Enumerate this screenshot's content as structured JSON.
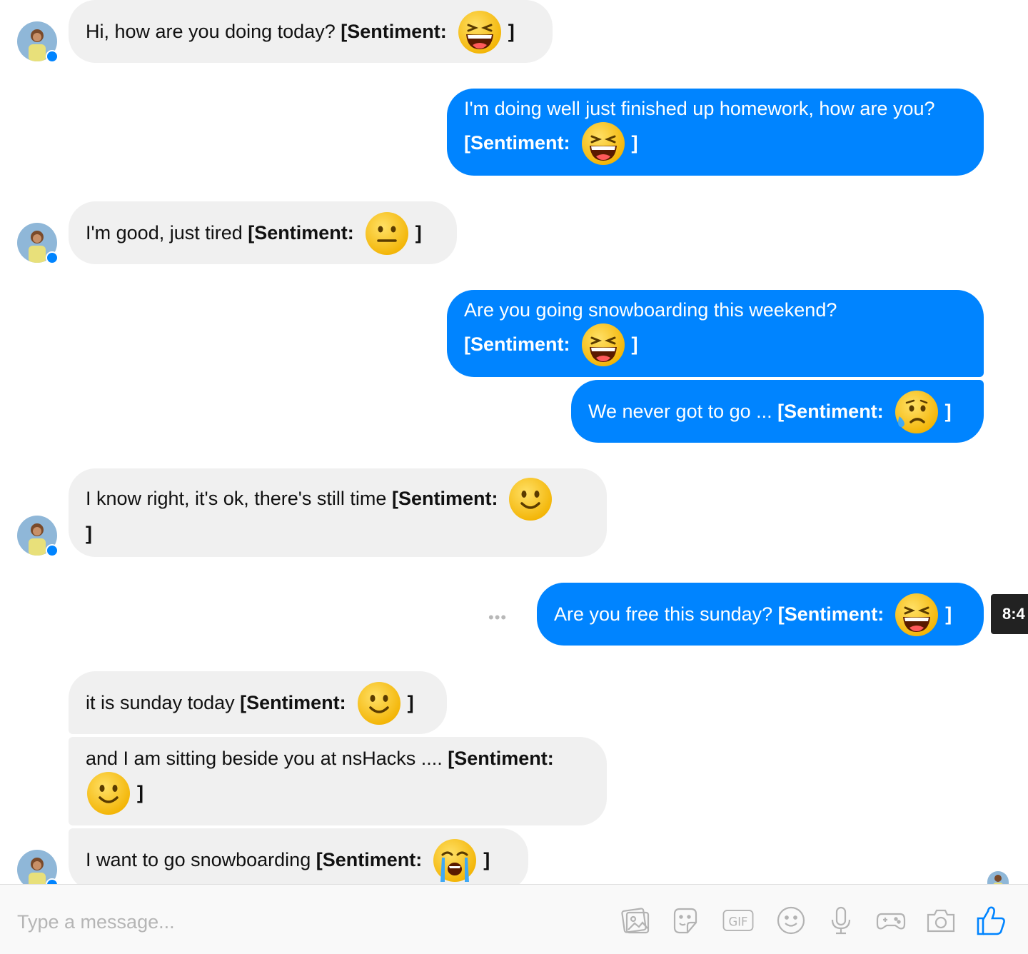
{
  "messages": [
    {
      "sender": "other",
      "text": "Hi, how are you doing today?",
      "sentiment_label": "[Sentiment:",
      "sentiment_emoji": "laughing-emoji",
      "close": "]"
    },
    {
      "sender": "self",
      "text": "I'm doing well just finished up homework, how are you?",
      "sentiment_label": "[Sentiment:",
      "sentiment_emoji": "laughing-emoji",
      "close": "]"
    },
    {
      "sender": "other",
      "text": "I'm good, just tired",
      "sentiment_label": "[Sentiment:",
      "sentiment_emoji": "neutral-face-emoji",
      "close": "]"
    },
    {
      "sender": "self",
      "text": "Are you going snowboarding this weekend?",
      "sentiment_label": "[Sentiment:",
      "sentiment_emoji": "laughing-emoji",
      "close": "]"
    },
    {
      "sender": "self",
      "text": "We never got to go ...",
      "sentiment_label": "[Sentiment:",
      "sentiment_emoji": "sad-sweat-emoji",
      "close": "]"
    },
    {
      "sender": "other",
      "text": "I know right, it's ok, there's still time",
      "sentiment_label": "[Sentiment:",
      "sentiment_emoji": "smile-emoji",
      "close": "]"
    },
    {
      "sender": "self",
      "text": "Are you free this sunday?",
      "sentiment_label": "[Sentiment:",
      "sentiment_emoji": "laughing-emoji",
      "close": "]"
    },
    {
      "sender": "other",
      "text": "it is sunday today",
      "sentiment_label": "[Sentiment:",
      "sentiment_emoji": "smile-emoji",
      "close": "]"
    },
    {
      "sender": "other",
      "text": "and I am sitting beside you at nsHacks ....",
      "sentiment_label": "[Sentiment:",
      "sentiment_emoji": "smile-emoji",
      "close": "]"
    },
    {
      "sender": "other",
      "text": "I want to go snowboarding",
      "sentiment_label": "[Sentiment:",
      "sentiment_emoji": "crying-emoji",
      "close": "]"
    }
  ],
  "tooltip": {
    "time": "8:4"
  },
  "more_options": "•••",
  "composer": {
    "placeholder": "Type a message...",
    "tools": [
      "image-icon",
      "sticker-icon",
      "gif-icon",
      "emoji-icon",
      "microphone-icon",
      "game-controller-icon",
      "camera-icon",
      "thumbs-up-icon"
    ],
    "gif_label": "GIF"
  },
  "colors": {
    "outgoing": "#0084ff",
    "incoming": "#f0f0f0",
    "icon": "#b3b3b3",
    "like": "#0084ff"
  }
}
